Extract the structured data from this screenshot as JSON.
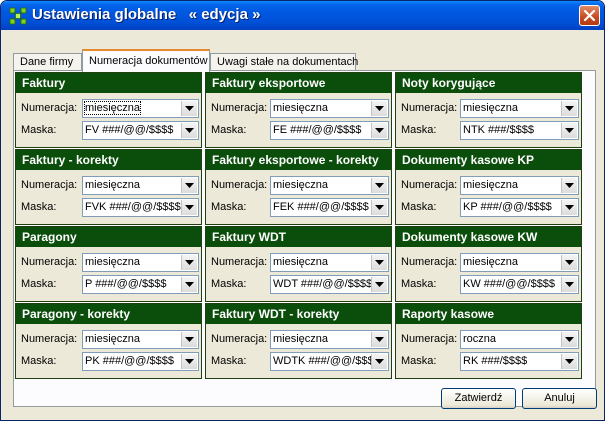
{
  "window": {
    "title": "Ustawienia globalne   « edycja »"
  },
  "tabs": [
    {
      "label": "Dane firmy"
    },
    {
      "label": "Numeracja dokumentów"
    },
    {
      "label": "Uwagi stałe na dokumentach"
    }
  ],
  "labels": {
    "numeracja": "Numeracja:",
    "maska": "Maska:"
  },
  "groups": [
    {
      "title": "Faktury",
      "numeracja": "miesięczna",
      "maska": "FV ###/@@/$$$$"
    },
    {
      "title": "Faktury eksportowe",
      "numeracja": "miesięczna",
      "maska": "FE ###/@@/$$$$"
    },
    {
      "title": "Noty korygujące",
      "numeracja": "miesięczna",
      "maska": "NTK ###/$$$$"
    },
    {
      "title": "Faktury - korekty",
      "numeracja": "miesięczna",
      "maska": "FVK ###/@@/$$$$"
    },
    {
      "title": "Faktury eksportowe - korekty",
      "numeracja": "miesięczna",
      "maska": "FEK ###/@@/$$$$"
    },
    {
      "title": "Dokumenty kasowe KP",
      "numeracja": "miesięczna",
      "maska": "KP ###/@@/$$$$"
    },
    {
      "title": "Paragony",
      "numeracja": "miesięczna",
      "maska": "P ###/@@/$$$$"
    },
    {
      "title": "Faktury WDT",
      "numeracja": "miesięczna",
      "maska": "WDT ###/@@/$$$$"
    },
    {
      "title": "Dokumenty kasowe KW",
      "numeracja": "miesięczna",
      "maska": "KW ###/@@/$$$$"
    },
    {
      "title": "Paragony - korekty",
      "numeracja": "miesięczna",
      "maska": "PK ###/@@/$$$$"
    },
    {
      "title": "Faktury WDT - korekty",
      "numeracja": "miesięczna",
      "maska": "WDTK ###/@@/$$$$"
    },
    {
      "title": "Raporty kasowe",
      "numeracja": "roczna",
      "maska": "RK ###/$$$$"
    }
  ],
  "buttons": {
    "confirm": "Zatwierdź",
    "cancel": "Anuluj"
  },
  "colors": {
    "title_bar": "#0054e3",
    "group_header": "#0b4d0b",
    "active_tab_accent": "#e68b2c"
  }
}
